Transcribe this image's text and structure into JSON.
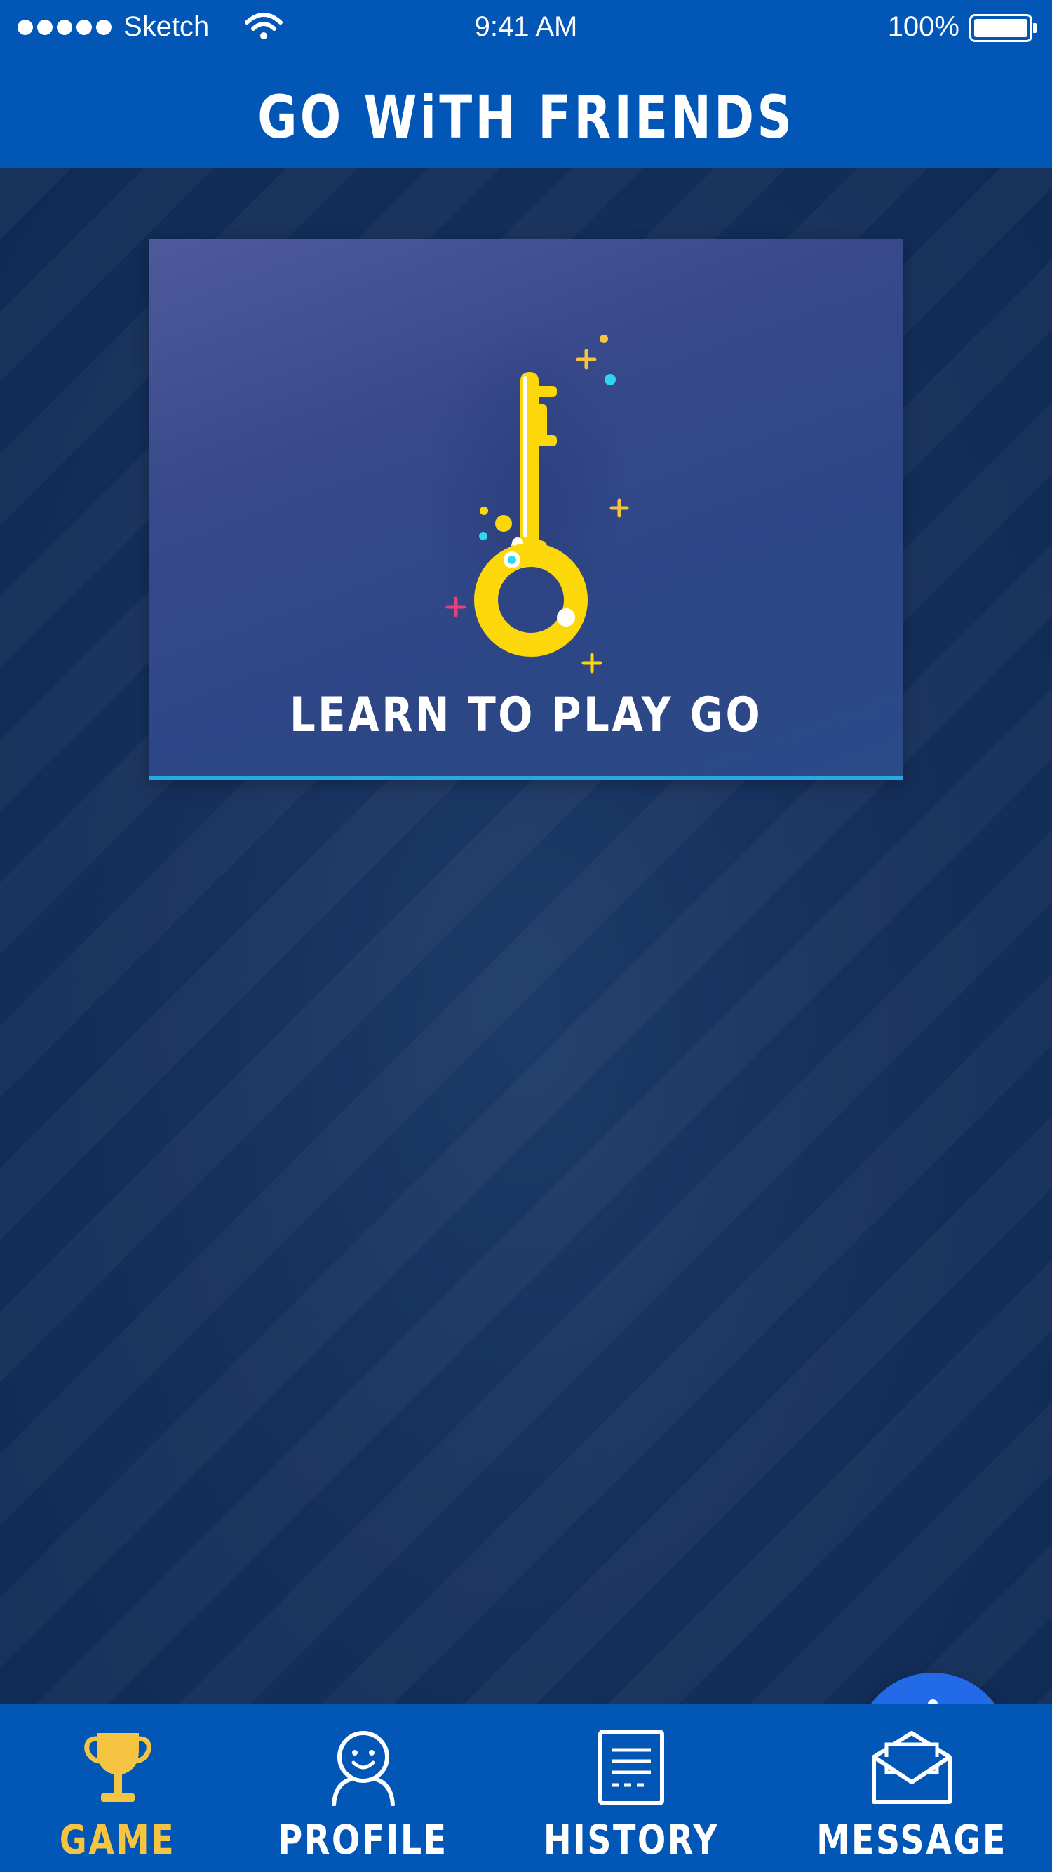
{
  "status_bar": {
    "carrier": "Sketch",
    "time": "9:41 AM",
    "battery_percent": "100%"
  },
  "header": {
    "title": "GO WiTH FRIENDS"
  },
  "card": {
    "title": "LEARN TO PLAY GO",
    "icon": "key-icon"
  },
  "fab": {
    "icon": "plus-icon"
  },
  "tabs": [
    {
      "label": "GAME",
      "icon": "trophy-icon",
      "active": true
    },
    {
      "label": "PROFILE",
      "icon": "user-icon",
      "active": false
    },
    {
      "label": "HISTORY",
      "icon": "document-icon",
      "active": false
    },
    {
      "label": "MESSAGE",
      "icon": "envelope-icon",
      "active": false
    }
  ],
  "colors": {
    "brand_blue": "#0256b6",
    "background": "#13294f",
    "accent_yellow": "#f5c542",
    "key_yellow": "#fcd80a",
    "fab_blue": "#236ae8",
    "card_border": "#29a8e3"
  }
}
